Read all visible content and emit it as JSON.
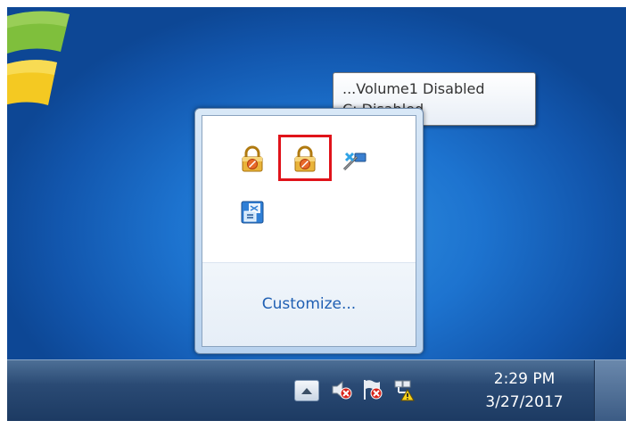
{
  "tooltip": {
    "line1": "...Volume1 Disabled",
    "line2": "C: Disabled"
  },
  "flyout": {
    "customize_label": "Customize...",
    "icons": [
      "lock-disabled-icon",
      "lock-disabled-icon",
      "network-disabled-icon",
      "language-bar-icon"
    ]
  },
  "taskbar": {
    "time": "2:29 PM",
    "date": "3/27/2017",
    "tray_icons": [
      "show-hidden-icons-arrow",
      "volume-muted-icon",
      "action-center-error-icon",
      "network-warning-icon"
    ]
  },
  "colors": {
    "highlight": "#e0131a",
    "link": "#1f5fb3"
  }
}
